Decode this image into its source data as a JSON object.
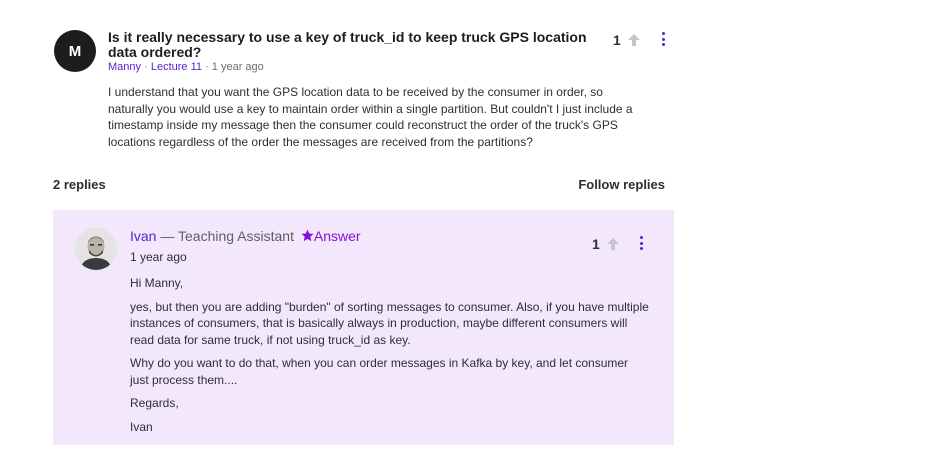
{
  "question": {
    "avatar_initial": "M",
    "title": "Is it really necessary to use a key of truck_id to keep truck GPS location data ordered?",
    "author": "Manny",
    "lecture": "Lecture 11",
    "time": "1 year ago",
    "body": "I understand that you want the GPS location data to be received by the consumer in order, so naturally you would use a key to maintain order within a single partition. But couldn't I just include a timestamp inside my message then the consumer could reconstruct the order of the truck's GPS locations regardless of the order the messages are received from the partitions?",
    "upvotes": "1"
  },
  "replies": {
    "count_label": "2 replies",
    "follow_label": "Follow replies"
  },
  "reply": {
    "name": "Ivan",
    "role": "— Teaching Assistant",
    "answer_label": "Answer",
    "time": "1 year ago",
    "upvotes": "1",
    "paragraphs": [
      "Hi Manny,",
      "yes, but then you are adding \"burden\" of sorting messages to consumer. Also, if you have multiple instances of consumers, that is basically always in production, maybe different consumers will read data for same truck, if not using truck_id as key.",
      "Why do you want to do that, when you can order messages in Kafka by key, and let consumer just process them....",
      "Regards,",
      "Ivan"
    ]
  },
  "colors": {
    "accent": "#5624d0",
    "answer": "#8710d8",
    "reply_bg": "#f3e8fb",
    "avatar_bg": "#1c1d1f"
  },
  "icons": [
    "upvote-arrow-icon",
    "kebab-menu-icon",
    "star-icon"
  ]
}
